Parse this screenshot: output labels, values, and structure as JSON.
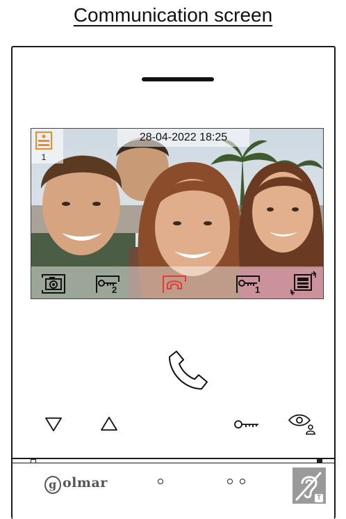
{
  "page": {
    "title": "Communication screen"
  },
  "screen": {
    "datetime": "28-04-2022 18:25",
    "monitor_number": "1",
    "toolbar": {
      "items": [
        {
          "id": "photo",
          "icon": "camera-icon",
          "label": ""
        },
        {
          "id": "key2",
          "icon": "key-icon",
          "label": "2"
        },
        {
          "id": "hangup",
          "icon": "hang-up-icon",
          "label": "",
          "color": "#e53935"
        },
        {
          "id": "key1",
          "icon": "key-icon",
          "label": "1"
        },
        {
          "id": "menu",
          "icon": "menu-switch-icon",
          "label": ""
        }
      ]
    }
  },
  "device": {
    "call_icon": "phone-handset-icon",
    "buttons": {
      "down": "down-triangle-icon",
      "up": "up-triangle-icon",
      "key": "key-icon",
      "monitor": "eye-person-icon"
    },
    "brand": "olmar",
    "brand_initial": "g",
    "hearing_icon": "hearing-loop-icon",
    "hearing_badge": "T"
  },
  "colors": {
    "accent_orange": "#f08a24",
    "hangup_red": "#e53935",
    "frame": "#1a1a1a"
  }
}
